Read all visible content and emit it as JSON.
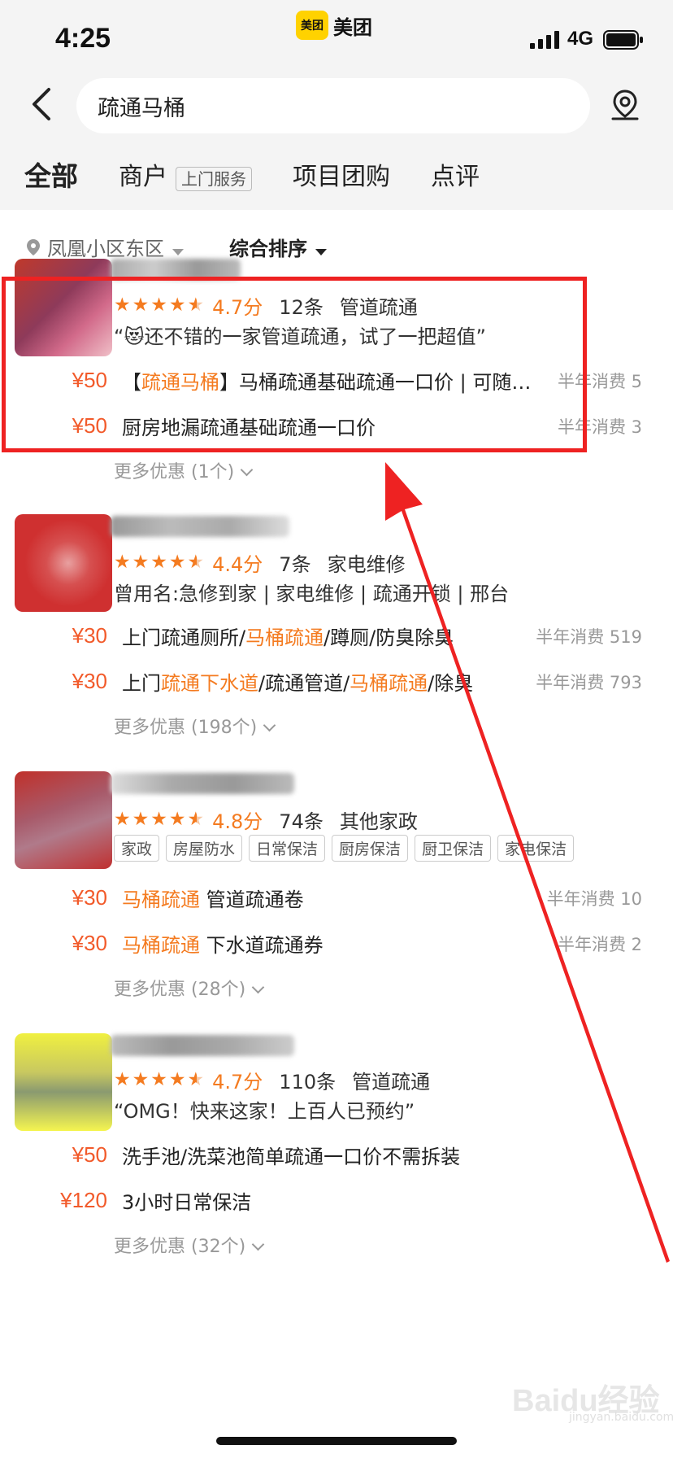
{
  "status_bar": {
    "time": "4:25",
    "network": "4G"
  },
  "app": {
    "logo_badge": "美团",
    "name": "美团",
    "brand_color": "#ffd200"
  },
  "search": {
    "query": "疏通马桶"
  },
  "tabs": [
    {
      "label": "全部",
      "active": true
    },
    {
      "label": "商户",
      "tag": "上门服务"
    },
    {
      "label": "项目团购"
    },
    {
      "label": "点评"
    }
  ],
  "filters": {
    "location": "凤凰小区东区",
    "sort": "综合排序"
  },
  "colors": {
    "price": "#f25a2a",
    "highlight": "#f47b20",
    "annotation": "#ee2222"
  },
  "merchants": [
    {
      "rating_stars": 4.5,
      "score": "4.7分",
      "reviews": "12条",
      "category": "管道疏通",
      "quote_open": "“",
      "quote_emoji": "😻",
      "quote": "还不错的一家管道疏通，试了一把超值”",
      "deals": [
        {
          "price": "¥50",
          "pre": "【",
          "hl": "疏通马桶",
          "post": "】马桶疏通基础疏通一口价 | 可随…",
          "sales": "半年消费 5"
        },
        {
          "price": "¥50",
          "pre": "厨房地漏疏通基础疏通一口价",
          "hl": "",
          "post": "",
          "sales": "半年消费 3"
        }
      ],
      "more": "更多优惠 (1个)"
    },
    {
      "rating_stars": 4.5,
      "score": "4.4分",
      "reviews": "7条",
      "category": "家电维修",
      "alias": "曾用名:急修到家 | 家电维修 | 疏通开锁 | 邢台",
      "deals": [
        {
          "price": "¥30",
          "pre": "上门疏通厕所/",
          "hl": "马桶疏通",
          "post": "/蹲厕/防臭除臭",
          "sales": "半年消费 519"
        },
        {
          "price": "¥30",
          "pre": "上门",
          "hl": "疏通下水道",
          "post": "/疏通管道/",
          "hl2": "马桶疏通",
          "post2": "/除臭",
          "sales": "半年消费 793"
        }
      ],
      "more": "更多优惠 (198个)"
    },
    {
      "rating_stars": 4.5,
      "score": "4.8分",
      "reviews": "74条",
      "category": "其他家政",
      "tags": [
        "家政",
        "房屋防水",
        "日常保洁",
        "厨房保洁",
        "厨卫保洁",
        "家电保洁"
      ],
      "deals": [
        {
          "price": "¥30",
          "pre": "",
          "hl": "马桶疏通",
          "post": " 管道疏通卷",
          "sales": "半年消费 10"
        },
        {
          "price": "¥30",
          "pre": "",
          "hl": "马桶疏通",
          "post": " 下水道疏通券",
          "sales": "半年消费 2"
        }
      ],
      "more": "更多优惠 (28个)"
    },
    {
      "rating_stars": 4.5,
      "score": "4.7分",
      "reviews": "110条",
      "category": "管道疏通",
      "quote": "“OMG！快来这家！上百人已预约”",
      "deals": [
        {
          "price": "¥50",
          "pre": "洗手池/洗菜池简单疏通一口价不需拆装",
          "hl": "",
          "post": "",
          "sales": ""
        },
        {
          "price": "¥120",
          "pre": "3小时日常保洁",
          "hl": "",
          "post": "",
          "sales": ""
        }
      ],
      "more": "更多优惠 (32个)"
    }
  ],
  "watermark": {
    "text": "Baidu经验",
    "sub": "jingyan.baidu.com"
  }
}
